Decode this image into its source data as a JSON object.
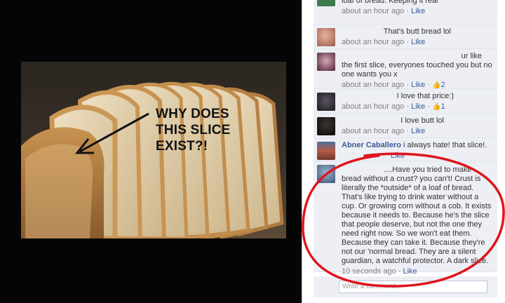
{
  "photo": {
    "meme_lines": [
      "WHY DOES",
      "THIS SLICE",
      "EXIST?!"
    ]
  },
  "sidebar": {
    "close_icon": "×",
    "comments": [
      {
        "text": "loaf of bread. Keeping it real",
        "time": "about an hour ago",
        "like_label": "Like",
        "avatar_color": "#3f7a4c"
      },
      {
        "text": "That's butt bread lol",
        "time": "about an hour ago",
        "like_label": "Like",
        "avatar_color": "#b8776a"
      },
      {
        "text_first": "ur like",
        "text_rest": "the first slice, everyones touched you but no one wants you x",
        "time": "about an hour ago",
        "like_label": "Like",
        "like_count": "2",
        "avatar_color": "#6b3b52"
      },
      {
        "text": "I love that price:)",
        "time": "about an hour ago",
        "like_label": "Like",
        "like_count": "1",
        "avatar_color": "#2d2a2e"
      },
      {
        "text": "I love butt lol",
        "time": "about an hour ago",
        "like_label": "Like",
        "avatar_color": "#1c1a18"
      },
      {
        "author": "Abner Caballero",
        "text": "i always hate! that slice!.",
        "time": "",
        "like_label": "Like",
        "avatar_color": "#8a4b3d"
      },
      {
        "text": "....Have you tried to make bread without a crust? you can't! Crust is literally the *outside* of a loaf of bread. That's like trying to drink water without a cup. Or growing corn without a cob. It exists because it needs to. Because he's the slice that people deserve, but not the one they need right now. So we won't eat them. Because they can take it. Because they're not our 'normal bread. They are a silent guardian, a watchful protector. A dark slice.",
        "time": "10 seconds ago",
        "like_label": "Like",
        "avatar_color": "#6f86a3"
      }
    ],
    "separator": "·",
    "write_placeholder": "Write a comment..."
  },
  "colors": {
    "link_blue": "#3b5998",
    "comment_bg": "#edeff4",
    "annotation_red": "#e0141c"
  }
}
